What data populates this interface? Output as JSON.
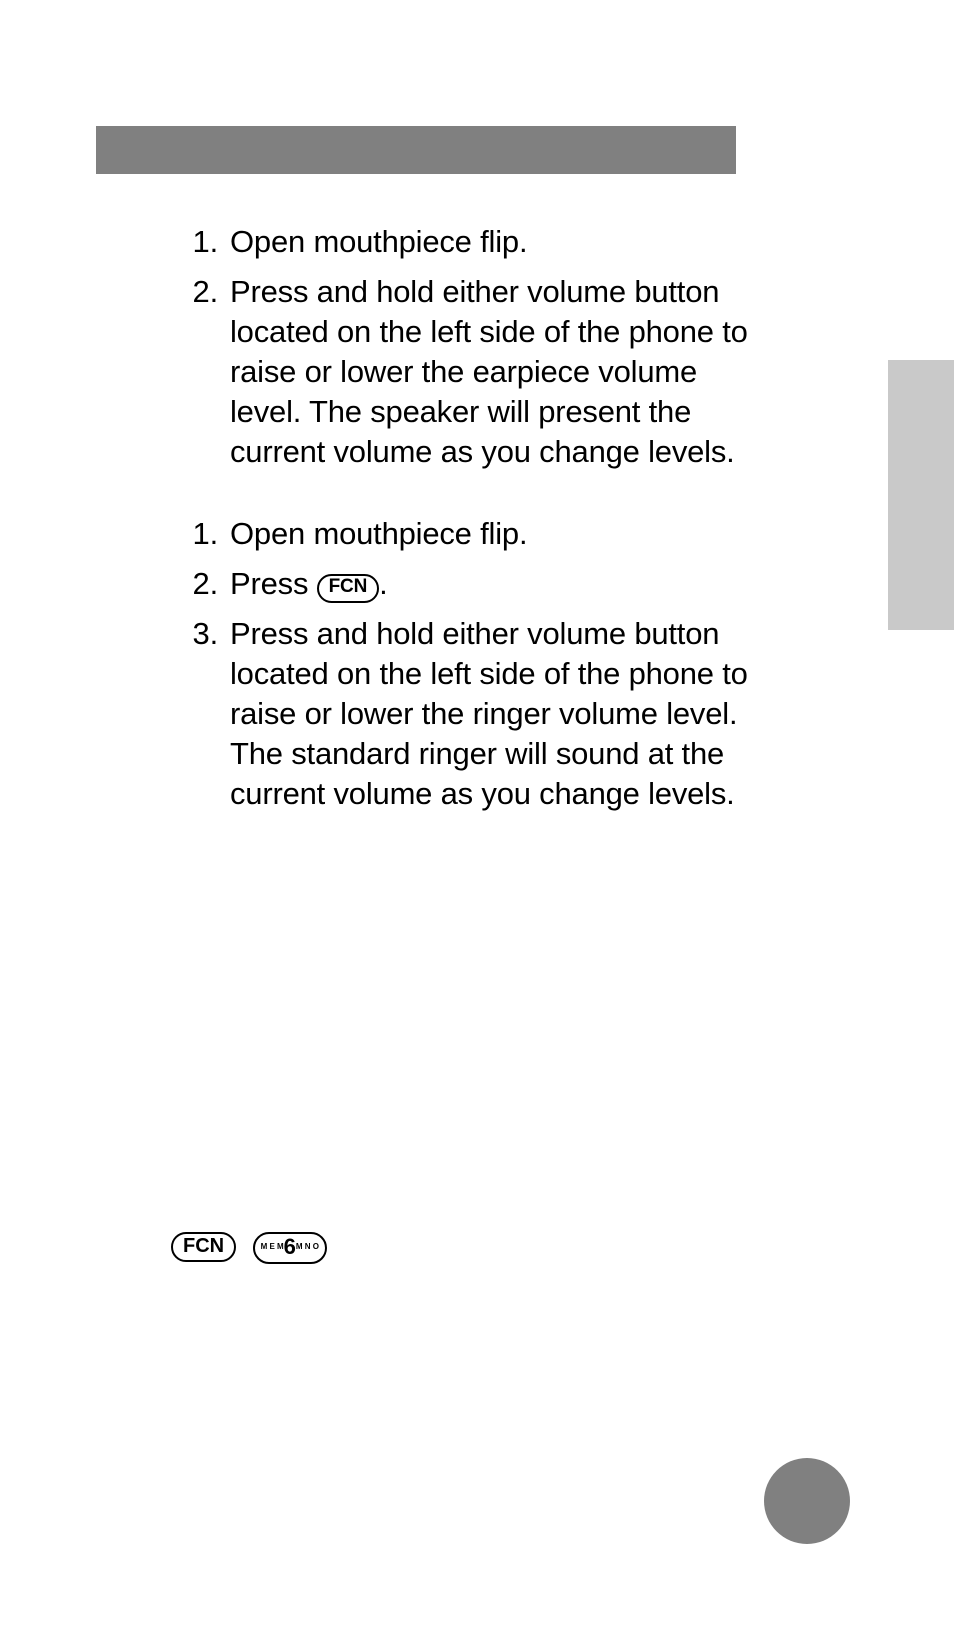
{
  "list1": {
    "items": [
      {
        "n": "1.",
        "text": "Open mouthpiece flip."
      },
      {
        "n": "2.",
        "text": "Press and hold either volume button located on the left side of the phone to raise or lower the earpiece volume level. The speaker will present the current volume as you change levels."
      }
    ]
  },
  "list2": {
    "items": [
      {
        "n": "1.",
        "text": "Open mouthpiece flip."
      },
      {
        "n": "2.",
        "pre": "Press ",
        "key": "FCN",
        "post": "."
      },
      {
        "n": "3.",
        "text": "Press and hold either volume button located on the left side of the phone to raise or lower the ringer volume level. The standard ringer will sound at the current volume as you change levels."
      }
    ]
  },
  "footer_keys": {
    "fcn": "FCN",
    "six_left": "M\nE\nM",
    "six_big": "6",
    "six_right": "M\nN\nO"
  }
}
